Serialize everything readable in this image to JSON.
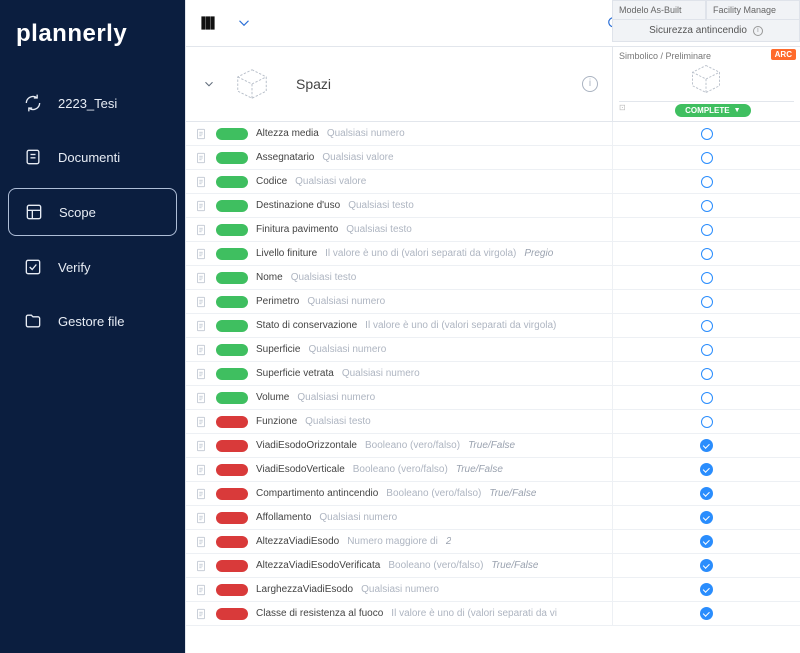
{
  "brand": "plannerly",
  "sidebar": {
    "items": [
      {
        "id": "project",
        "label": "2223_Tesi",
        "icon": "cycle"
      },
      {
        "id": "documenti",
        "label": "Documenti",
        "icon": "doc"
      },
      {
        "id": "scope",
        "label": "Scope",
        "icon": "layout",
        "active": true
      },
      {
        "id": "verify",
        "label": "Verify",
        "icon": "check"
      },
      {
        "id": "gestore",
        "label": "Gestore file",
        "icon": "folder"
      }
    ]
  },
  "toolbar": {
    "top_tabs": [
      "Modelo As-Built",
      "Facility Manage"
    ],
    "sub_tab": "Sicurezza antincendio"
  },
  "header": {
    "section_title": "Spazi",
    "column": {
      "label": "Simbolico / Preliminare",
      "badge_arc": "ARC",
      "status": "COMPLETE"
    }
  },
  "rows": [
    {
      "color": "green",
      "name": "Altezza media",
      "desc": "Qualsiasi numero",
      "extra": "",
      "status": "open"
    },
    {
      "color": "green",
      "name": "Assegnatario",
      "desc": "Qualsiasi valore",
      "extra": "",
      "status": "open"
    },
    {
      "color": "green",
      "name": "Codice",
      "desc": "Qualsiasi valore",
      "extra": "",
      "status": "open"
    },
    {
      "color": "green",
      "name": "Destinazione d'uso",
      "desc": "Qualsiasi testo",
      "extra": "",
      "status": "open"
    },
    {
      "color": "green",
      "name": "Finitura pavimento",
      "desc": "Qualsiasi testo",
      "extra": "",
      "status": "open"
    },
    {
      "color": "green",
      "name": "Livello finiture",
      "desc": "Il valore è uno di (valori separati da virgola)",
      "extra": "Pregio",
      "status": "open"
    },
    {
      "color": "green",
      "name": "Nome",
      "desc": "Qualsiasi testo",
      "extra": "",
      "status": "open"
    },
    {
      "color": "green",
      "name": "Perimetro",
      "desc": "Qualsiasi numero",
      "extra": "",
      "status": "open"
    },
    {
      "color": "green",
      "name": "Stato di conservazione",
      "desc": "Il valore è uno di (valori separati da virgola)",
      "extra": "",
      "status": "open"
    },
    {
      "color": "green",
      "name": "Superficie",
      "desc": "Qualsiasi numero",
      "extra": "",
      "status": "open"
    },
    {
      "color": "green",
      "name": "Superficie vetrata",
      "desc": "Qualsiasi numero",
      "extra": "",
      "status": "open"
    },
    {
      "color": "green",
      "name": "Volume",
      "desc": "Qualsiasi numero",
      "extra": "",
      "status": "open"
    },
    {
      "color": "red",
      "name": "Funzione",
      "desc": "Qualsiasi testo",
      "extra": "",
      "status": "open"
    },
    {
      "color": "red",
      "name": "ViadiEsodoOrizzontale",
      "desc": "Booleano (vero/falso)",
      "extra": "True/False",
      "status": "check"
    },
    {
      "color": "red",
      "name": "ViadiEsodoVerticale",
      "desc": "Booleano (vero/falso)",
      "extra": "True/False",
      "status": "check"
    },
    {
      "color": "red",
      "name": "Compartimento antincendio",
      "desc": "Booleano (vero/falso)",
      "extra": "True/False",
      "status": "check"
    },
    {
      "color": "red",
      "name": "Affollamento",
      "desc": "Qualsiasi numero",
      "extra": "",
      "status": "check"
    },
    {
      "color": "red",
      "name": "AltezzaViadiEsodo",
      "desc": "Numero maggiore di",
      "extra": "2",
      "status": "check"
    },
    {
      "color": "red",
      "name": "AltezzaViadiEsodoVerificata",
      "desc": "Booleano (vero/falso)",
      "extra": "True/False",
      "status": "check"
    },
    {
      "color": "red",
      "name": "LarghezzaViadiEsodo",
      "desc": "Qualsiasi numero",
      "extra": "",
      "status": "check"
    },
    {
      "color": "red",
      "name": "Classe di resistenza al fuoco",
      "desc": "Il valore è uno di (valori separati da vi",
      "extra": "",
      "status": "check"
    }
  ]
}
